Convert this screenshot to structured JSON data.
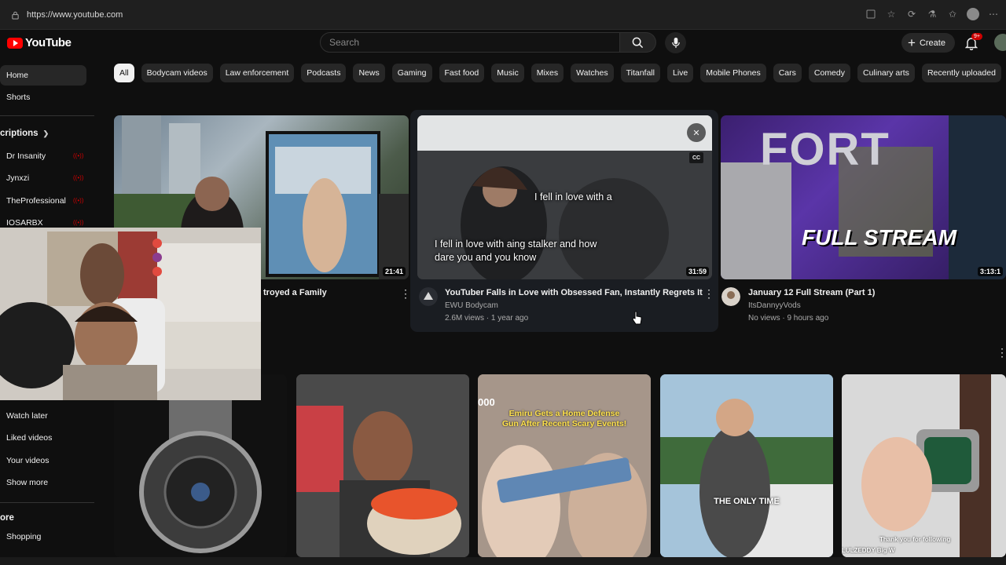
{
  "browser": {
    "url": "https://www.youtube.com",
    "icons": [
      "lock-icon",
      "extensions-icon",
      "star-icon",
      "refresh-icon",
      "beaker-icon",
      "favorites-icon",
      "profile-avatar",
      "more-icon"
    ]
  },
  "header": {
    "logo_text": "YouTube",
    "search_placeholder": "Search",
    "create_label": "Create",
    "notification_badge": "9+"
  },
  "chips": [
    "All",
    "Bodycam videos",
    "Law enforcement",
    "Podcasts",
    "News",
    "Gaming",
    "Fast food",
    "Music",
    "Mixes",
    "Watches",
    "Titanfall",
    "Live",
    "Mobile Phones",
    "Cars",
    "Comedy",
    "Culinary arts",
    "Recently uploaded"
  ],
  "sidebar": {
    "top": [
      "Home",
      "Shorts"
    ],
    "subscriptions_label": "criptions",
    "subscriptions": [
      "Dr Insanity",
      "Jynxzi",
      "TheProfessional",
      "IOSARBX"
    ],
    "you": [
      "Watch later",
      "Liked videos",
      "Your videos",
      "Show more"
    ],
    "explore_label": "ore",
    "explore": [
      "Shopping"
    ]
  },
  "videos": [
    {
      "title": "troyed a Family",
      "duration": "21:41",
      "channel": "",
      "meta": ""
    },
    {
      "title": "YouTuber Falls in Love with Obsessed Fan, Instantly Regrets It",
      "duration": "31:59",
      "channel": "EWU Bodycam",
      "meta": "2.6M views · 1 year ago",
      "caption_top": "I fell in love with a",
      "caption_bottom_1": "I fell in love with aing stalker and how",
      "caption_bottom_2": "dare you and you know"
    },
    {
      "title": "January 12 Full Stream (Part 1)",
      "duration": "3:13:1",
      "channel": "ItsDannyyVods",
      "meta": "No views · 9 hours ago",
      "thumb_text_1": "FORT",
      "thumb_text_2": "FULL STREAM"
    }
  ],
  "shorts": [
    {
      "overlay": ""
    },
    {
      "overlay": ""
    },
    {
      "overlay_1": "Emiru Gets a Home Defense",
      "overlay_2": "Gun After Recent Scary Events!",
      "corner": "000"
    },
    {
      "overlay": "THE ONLY TIME"
    },
    {
      "overlay": "Thank you for following",
      "overlay_2": "LULZEDDY Big W"
    }
  ],
  "colors": {
    "background": "#0f0f0f",
    "chip": "#272727",
    "brand_red": "#ff0000",
    "hover_card": "#1a1d22"
  }
}
